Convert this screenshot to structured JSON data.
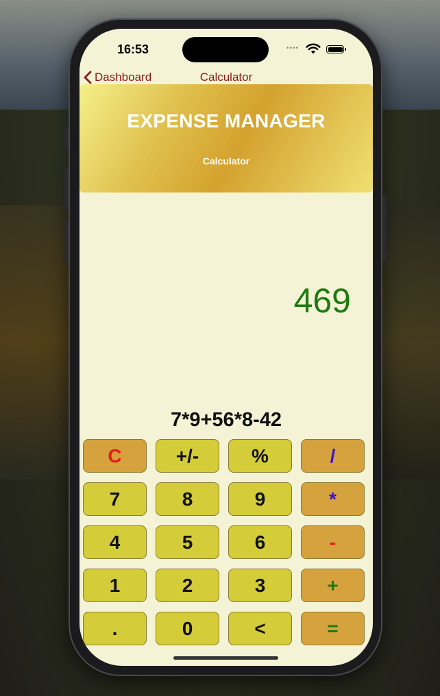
{
  "status": {
    "time": "16:53",
    "signal_dots": "••••"
  },
  "nav": {
    "back_label": "Dashboard",
    "title": "Calculator"
  },
  "banner": {
    "title": "EXPENSE MANAGER",
    "subtitle": "Calculator"
  },
  "display": {
    "result": "469",
    "expression": "7*9+56*8-42"
  },
  "colors": {
    "accent": "#8b1a1a",
    "result": "#1e7a0f",
    "num_key": "#d4cc38",
    "op_key": "#d5a23e"
  },
  "keys": [
    {
      "label": "C",
      "color": "#e31b1b",
      "kind": "op"
    },
    {
      "label": "+/-",
      "color": "#111111",
      "kind": "num"
    },
    {
      "label": "%",
      "color": "#111111",
      "kind": "num"
    },
    {
      "label": "/",
      "color": "#3a10d8",
      "kind": "op"
    },
    {
      "label": "7",
      "color": "#111111",
      "kind": "num"
    },
    {
      "label": "8",
      "color": "#111111",
      "kind": "num"
    },
    {
      "label": "9",
      "color": "#111111",
      "kind": "num"
    },
    {
      "label": "*",
      "color": "#3a10d8",
      "kind": "op"
    },
    {
      "label": "4",
      "color": "#111111",
      "kind": "num"
    },
    {
      "label": "5",
      "color": "#111111",
      "kind": "num"
    },
    {
      "label": "6",
      "color": "#111111",
      "kind": "num"
    },
    {
      "label": "-",
      "color": "#e31b1b",
      "kind": "op"
    },
    {
      "label": "1",
      "color": "#111111",
      "kind": "num"
    },
    {
      "label": "2",
      "color": "#111111",
      "kind": "num"
    },
    {
      "label": "3",
      "color": "#111111",
      "kind": "num"
    },
    {
      "label": "+",
      "color": "#1e7a0f",
      "kind": "op"
    },
    {
      "label": ".",
      "color": "#111111",
      "kind": "num"
    },
    {
      "label": "0",
      "color": "#111111",
      "kind": "num"
    },
    {
      "label": "<",
      "color": "#111111",
      "kind": "num"
    },
    {
      "label": "=",
      "color": "#1e7a0f",
      "kind": "op"
    }
  ]
}
